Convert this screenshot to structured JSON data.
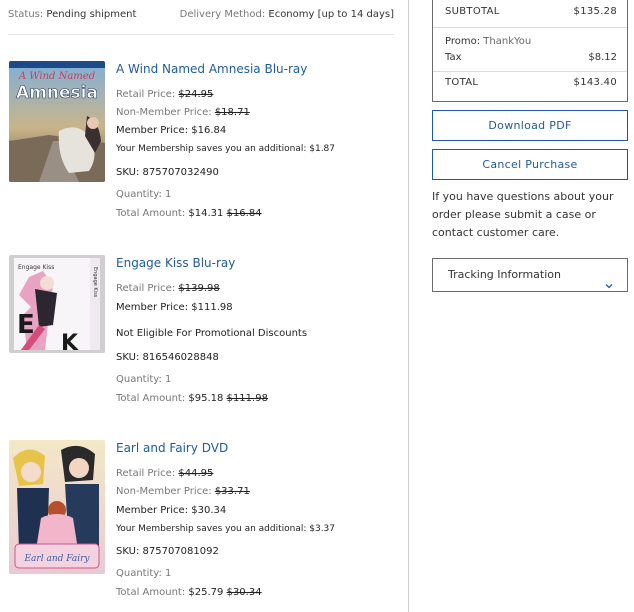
{
  "header": {
    "status_label": "Status:",
    "status_value": "Pending shipment",
    "delivery_label": "Delivery Method:",
    "delivery_value": "Economy [up to 14 days]"
  },
  "items": [
    {
      "title": "A Wind Named Amnesia Blu-ray",
      "cover_text": "Amnesia",
      "cover_script": "A Wind Named",
      "retail_label": "Retail Price:",
      "retail_price": "$24.95",
      "nonmember_label": "Non-Member Price:",
      "nonmember_price": "$18.71",
      "member_label": "Member Price:",
      "member_price": "$16.84",
      "savings_note": "Your Membership saves you an additional: $1.87",
      "sku": "SKU: 875707032490",
      "quantity": "Quantity: 1",
      "total_label": "Total Amount:",
      "total_price": "$14.31",
      "total_original": "$16.84"
    },
    {
      "title": "Engage Kiss Blu-ray",
      "cover_text": "Engage Kiss",
      "retail_label": "Retail Price:",
      "retail_price": "$139.98",
      "member_label": "Member Price:",
      "member_price": "$111.98",
      "eligibility": "Not Eligible For Promotional Discounts",
      "sku": "SKU: 816546028848",
      "quantity": "Quantity: 1",
      "total_label": "Total Amount:",
      "total_price": "$95.18",
      "total_original": "$111.98"
    },
    {
      "title": "Earl and Fairy DVD",
      "cover_text": "Earl and Fairy",
      "retail_label": "Retail Price:",
      "retail_price": "$44.95",
      "nonmember_label": "Non-Member Price:",
      "nonmember_price": "$33.71",
      "member_label": "Member Price:",
      "member_price": "$30.34",
      "savings_note": "Your Membership saves you an additional: $3.37",
      "sku": "SKU: 875707081092",
      "quantity": "Quantity: 1",
      "total_label": "Total Amount:",
      "total_price": "$25.79",
      "total_original": "$30.34"
    }
  ],
  "summary": {
    "subtotal_label": "SUBTOTAL",
    "subtotal_value": "$135.28",
    "promo_label": "Promo:",
    "promo_code": "ThankYou",
    "tax_label": "Tax",
    "tax_value": "$8.12",
    "total_label": "TOTAL",
    "total_value": "$143.40"
  },
  "actions": {
    "download_pdf": "Download PDF",
    "cancel_purchase": "Cancel Purchase"
  },
  "help_text": "If you have questions about your order please submit a case or contact customer care.",
  "tracking": {
    "label": "Tracking Information"
  },
  "colors": {
    "link_blue": "#1f5b9a",
    "border_grey": "#6b6b6b"
  }
}
